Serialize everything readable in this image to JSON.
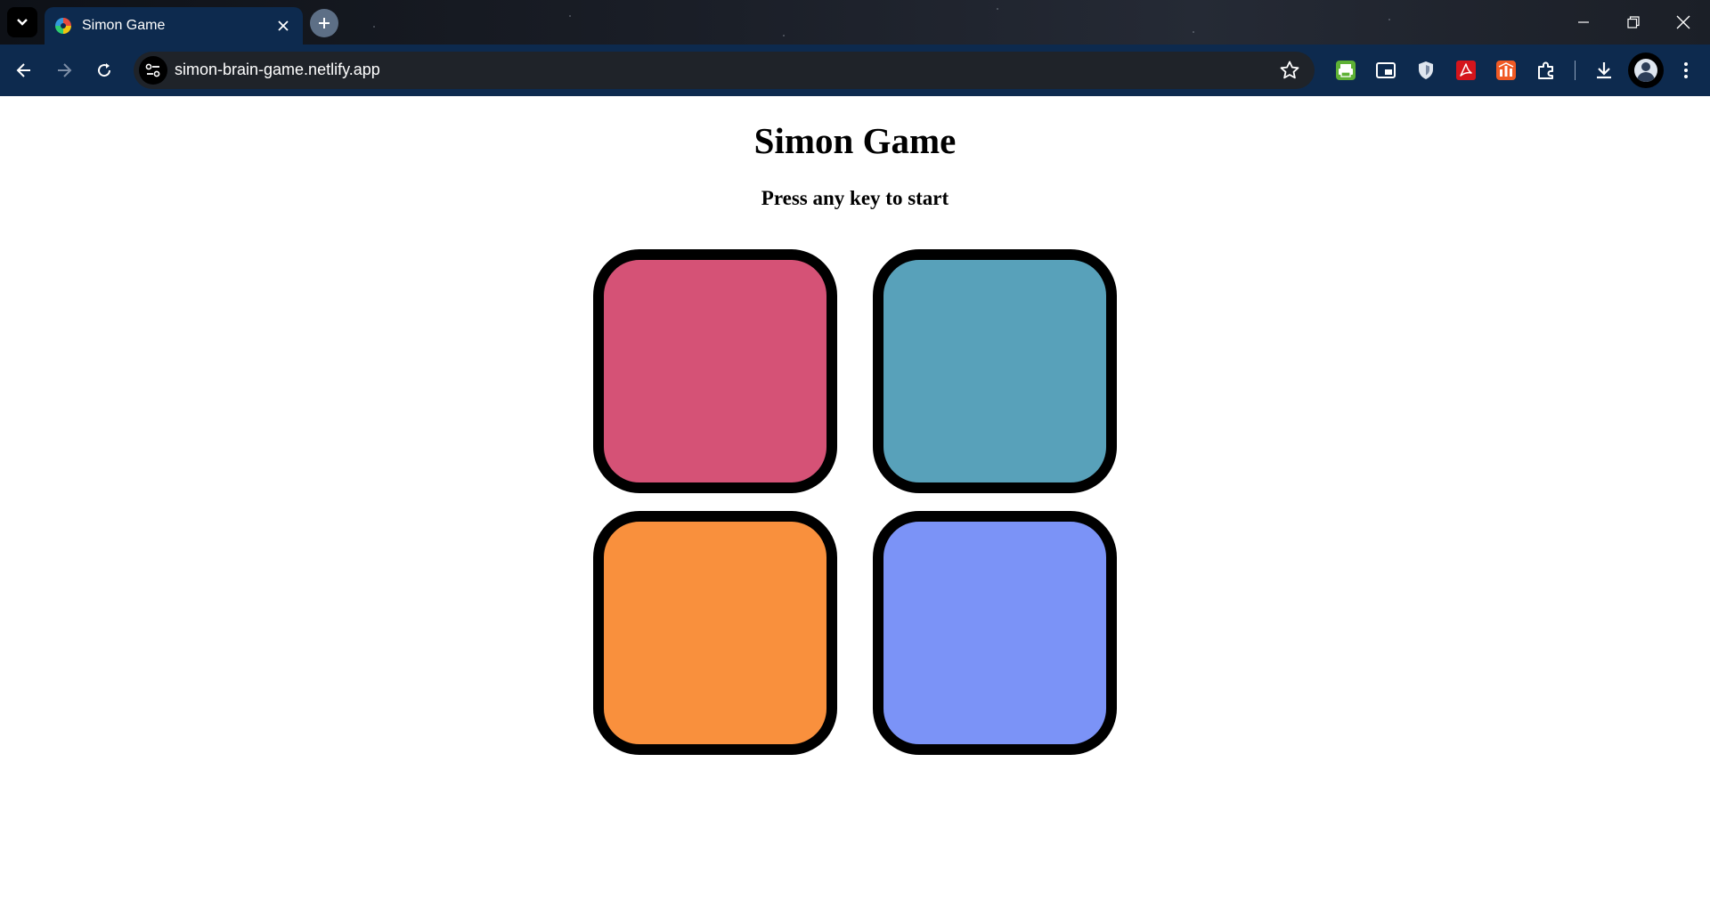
{
  "browser": {
    "tab": {
      "title": "Simon Game"
    },
    "address_bar": {
      "url": "simon-brain-game.netlify.app"
    }
  },
  "page": {
    "title": "Simon Game",
    "subtitle": "Press any key to start",
    "buttons": [
      {
        "id": "red",
        "color": "#d55276"
      },
      {
        "id": "green",
        "color": "#58a1ba"
      },
      {
        "id": "yellow",
        "color": "#f9903d"
      },
      {
        "id": "blue",
        "color": "#7b93f7"
      }
    ]
  },
  "colors": {
    "browser_chrome": "#0d2a4e",
    "omnibox": "#1f2329",
    "button_border": "#000000"
  }
}
